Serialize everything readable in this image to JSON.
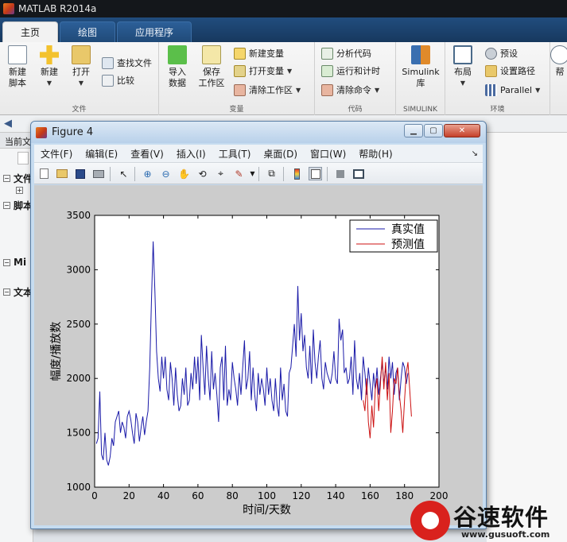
{
  "app": {
    "title": "MATLAB R2014a"
  },
  "tabs": [
    {
      "label": "主页"
    },
    {
      "label": "绘图"
    },
    {
      "label": "应用程序"
    }
  ],
  "ribbon": {
    "file_group": {
      "label": "文件",
      "new_script": "新建\n脚本",
      "new": "新建",
      "open": "打开",
      "find_files": "查找文件",
      "compare": "比较"
    },
    "variable_group": {
      "label": "变量",
      "import_data": "导入\n数据",
      "save_workspace": "保存\n工作区",
      "new_variable": "新建变量",
      "open_variable": "打开变量",
      "clear_workspace": "清除工作区"
    },
    "code_group": {
      "label": "代码",
      "analyze_code": "分析代码",
      "run_and_time": "运行和计时",
      "clear_commands": "清除命令"
    },
    "simulink_group": {
      "label": "SIMULINK",
      "simulink_library": "Simulink\n库"
    },
    "environment_group": {
      "label": "环境",
      "layout": "布局",
      "preferences": "预设",
      "set_path": "设置路径",
      "parallel": "Parallel"
    },
    "help_partial": "帮"
  },
  "current_folder": {
    "label": "当前文"
  },
  "left_panel": {
    "items": [
      "文件",
      "脚本",
      "Mi",
      "文本"
    ]
  },
  "figure": {
    "title": "Figure 4",
    "menu": [
      "文件(F)",
      "编辑(E)",
      "查看(V)",
      "插入(I)",
      "工具(T)",
      "桌面(D)",
      "窗口(W)",
      "帮助(H)"
    ]
  },
  "chart_data": {
    "type": "line",
    "xlabel": "时间/天数",
    "ylabel": "幅度/播放数",
    "xlim": [
      0,
      200
    ],
    "ylim": [
      1000,
      3500
    ],
    "xticks": [
      0,
      20,
      40,
      60,
      80,
      100,
      120,
      140,
      160,
      180,
      200
    ],
    "yticks": [
      1000,
      1500,
      2000,
      2500,
      3000,
      3500
    ],
    "legend_position": "top-right",
    "grid": false,
    "series": [
      {
        "name": "真实值",
        "color": "#1a1aa8",
        "x_start": 1,
        "values": [
          1400,
          1450,
          1880,
          1300,
          1250,
          1500,
          1250,
          1200,
          1280,
          1450,
          1380,
          1600,
          1650,
          1700,
          1500,
          1600,
          1550,
          1450,
          1650,
          1700,
          1620,
          1500,
          1400,
          1680,
          1600,
          1420,
          1550,
          1650,
          1480,
          1600,
          1700,
          2100,
          2700,
          3260,
          2800,
          2250,
          2000,
          1880,
          2200,
          2000,
          2200,
          1900,
          1800,
          2150,
          2000,
          1750,
          2100,
          1850,
          1700,
          1750,
          2000,
          1850,
          2100,
          1750,
          1800,
          2050,
          1900,
          2200,
          1950,
          2200,
          1800,
          2400,
          2100,
          1850,
          2300,
          2000,
          1800,
          2250,
          1900,
          2050,
          1850,
          1600,
          2100,
          2200,
          1800,
          2300,
          1750,
          1900,
          1800,
          2150,
          2000,
          1900,
          1750,
          2050,
          1850,
          2100,
          2350,
          1900,
          2000,
          2250,
          1800,
          2100,
          1850,
          1700,
          2050,
          1850,
          2000,
          1900,
          1750,
          2100,
          1850,
          2000,
          1800,
          1700,
          2000,
          1750,
          1650,
          2100,
          1800,
          1950,
          1700,
          1650,
          2050,
          2100,
          2300,
          2500,
          2200,
          2850,
          2350,
          2600,
          2250,
          2400,
          2100,
          2000,
          2300,
          1950,
          2450,
          2150,
          2000,
          2200,
          2350,
          2000,
          1900,
          2150,
          2050,
          2000,
          1950,
          2050,
          2250,
          2000,
          1950,
          2550,
          2350,
          2450,
          2050,
          2100,
          1950,
          2000,
          2200,
          1850,
          2350,
          2000,
          1900,
          2050,
          1800,
          2200,
          2050,
          1850,
          2100,
          1950,
          1800,
          2050,
          1900,
          2100,
          1850,
          2000,
          2150,
          1950,
          2100,
          1900,
          2200,
          2000,
          2150,
          1850,
          2050,
          2100,
          1800,
          2000,
          2150,
          2100,
          1950,
          2050
        ]
      },
      {
        "name": "预测值",
        "color": "#cc1111",
        "x_start": 156,
        "values": [
          1800,
          1700,
          2000,
          1600,
          1450,
          1750,
          1550,
          1900,
          2000,
          1700,
          1950,
          2200,
          1900,
          2150,
          1800,
          2050,
          1500,
          1700,
          2000,
          1950,
          2100,
          1850,
          1700,
          1500,
          1800,
          2050,
          2150,
          1900,
          1650
        ]
      }
    ]
  },
  "watermark": {
    "text": "谷速软件",
    "url": "www.gusuoft.com"
  }
}
